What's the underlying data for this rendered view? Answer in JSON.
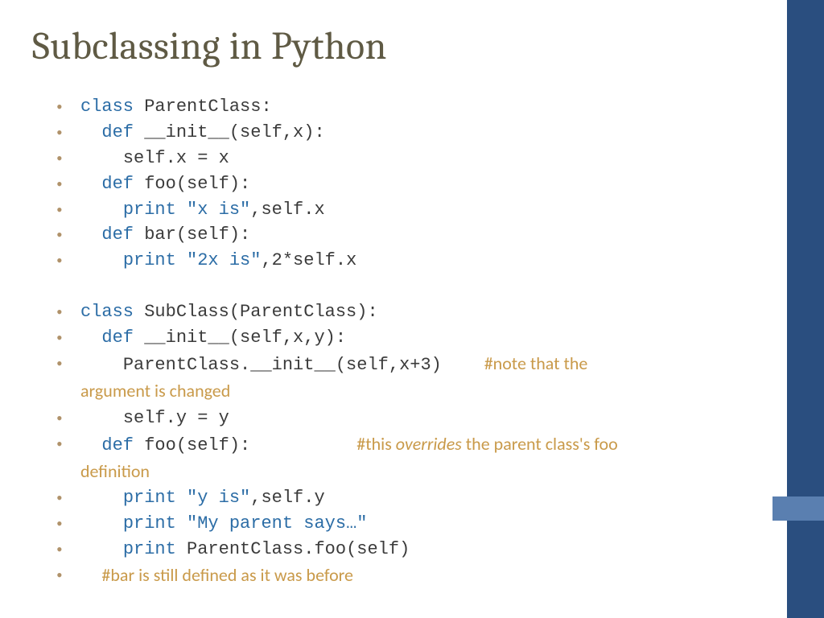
{
  "title": "Subclassing in Python",
  "lines": {
    "l1_kw": "class",
    "l1_rest": " ParentClass:",
    "l2_kw": "def",
    "l2_rest": " __init__(self,x):",
    "l3": "self.x = x",
    "l4_kw": "def",
    "l4_rest": " foo(self):",
    "l5_kw": "print",
    "l5_str": " \"x is\"",
    "l5_rest": ",self.x",
    "l6_kw": "def",
    "l6_rest": " bar(self):",
    "l7_kw": "print",
    "l7_str": " \"2x is\"",
    "l7_rest": ",2*self.x",
    "l8_kw": "class",
    "l8_rest": " SubClass(ParentClass):",
    "l9_kw": "def",
    "l9_rest": " __init__(self,x,y):",
    "l10_code": "ParentClass.__init__(self,x+3)    ",
    "l10_c1": "#note that  the ",
    "l10_c2": "argument is changed",
    "l11": "self.y = y",
    "l12_kw": "def",
    "l12_rest": " foo(self):          ",
    "l12_c1": "#this ",
    "l12_c2": "overrides",
    "l12_c3": " the parent class's foo ",
    "l12_c4": "definition",
    "l13_kw": "print",
    "l13_str": " \"y is\"",
    "l13_rest": ",self.y",
    "l14_kw": "print",
    "l14_str": " \"My parent says…\"",
    "l15_kw": "print",
    "l15_rest": " ParentClass.foo(self)",
    "l16_c": "#bar is still defined as it was before"
  }
}
